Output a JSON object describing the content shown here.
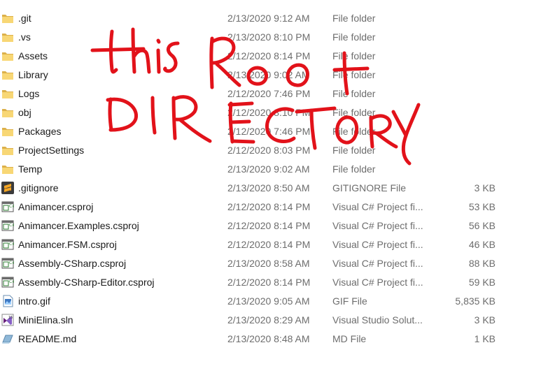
{
  "files": [
    {
      "name": ".git",
      "date": "2/13/2020 9:12 AM",
      "type": "File folder",
      "size": "",
      "icon": "folder-icon"
    },
    {
      "name": ".vs",
      "date": "2/13/2020 8:10 PM",
      "type": "File folder",
      "size": "",
      "icon": "folder-icon"
    },
    {
      "name": "Assets",
      "date": "2/12/2020 8:14 PM",
      "type": "File folder",
      "size": "",
      "icon": "folder-icon"
    },
    {
      "name": "Library",
      "date": "2/13/2020 9:02 AM",
      "type": "File folder",
      "size": "",
      "icon": "folder-icon"
    },
    {
      "name": "Logs",
      "date": "2/12/2020 7:46 PM",
      "type": "File folder",
      "size": "",
      "icon": "folder-icon"
    },
    {
      "name": "obj",
      "date": "2/12/2020 8:10 PM",
      "type": "File folder",
      "size": "",
      "icon": "folder-icon"
    },
    {
      "name": "Packages",
      "date": "2/12/2020 7:46 PM",
      "type": "File folder",
      "size": "",
      "icon": "folder-icon"
    },
    {
      "name": "ProjectSettings",
      "date": "2/12/2020 8:03 PM",
      "type": "File folder",
      "size": "",
      "icon": "folder-icon"
    },
    {
      "name": "Temp",
      "date": "2/13/2020 9:02 AM",
      "type": "File folder",
      "size": "",
      "icon": "folder-icon"
    },
    {
      "name": ".gitignore",
      "date": "2/13/2020 8:50 AM",
      "type": "GITIGNORE File",
      "size": "3 KB",
      "icon": "sublime-text-icon"
    },
    {
      "name": "Animancer.csproj",
      "date": "2/12/2020 8:14 PM",
      "type": "Visual C# Project fi...",
      "size": "53 KB",
      "icon": "csproj-file-icon"
    },
    {
      "name": "Animancer.Examples.csproj",
      "date": "2/12/2020 8:14 PM",
      "type": "Visual C# Project fi...",
      "size": "56 KB",
      "icon": "csproj-file-icon"
    },
    {
      "name": "Animancer.FSM.csproj",
      "date": "2/12/2020 8:14 PM",
      "type": "Visual C# Project fi...",
      "size": "46 KB",
      "icon": "csproj-file-icon"
    },
    {
      "name": "Assembly-CSharp.csproj",
      "date": "2/13/2020 8:58 AM",
      "type": "Visual C# Project fi...",
      "size": "88 KB",
      "icon": "csproj-file-icon"
    },
    {
      "name": "Assembly-CSharp-Editor.csproj",
      "date": "2/12/2020 8:14 PM",
      "type": "Visual C# Project fi...",
      "size": "59 KB",
      "icon": "csproj-file-icon"
    },
    {
      "name": "intro.gif",
      "date": "2/13/2020 9:05 AM",
      "type": "GIF File",
      "size": "5,835 KB",
      "icon": "image-file-icon"
    },
    {
      "name": "MiniElina.sln",
      "date": "2/13/2020 8:29 AM",
      "type": "Visual Studio Solut...",
      "size": "3 KB",
      "icon": "visual-studio-solution-icon"
    },
    {
      "name": "README.md",
      "date": "2/13/2020 8:48 AM",
      "type": "MD File",
      "size": "1 KB",
      "icon": "markdown-file-icon"
    }
  ],
  "annotation": {
    "line1": "this Root",
    "line2": "DIRECTORY",
    "color": "#e2121a"
  },
  "colors": {
    "folder": "#f5c542",
    "text": "#1a1a1a",
    "meta_text": "#6d6d6d"
  }
}
